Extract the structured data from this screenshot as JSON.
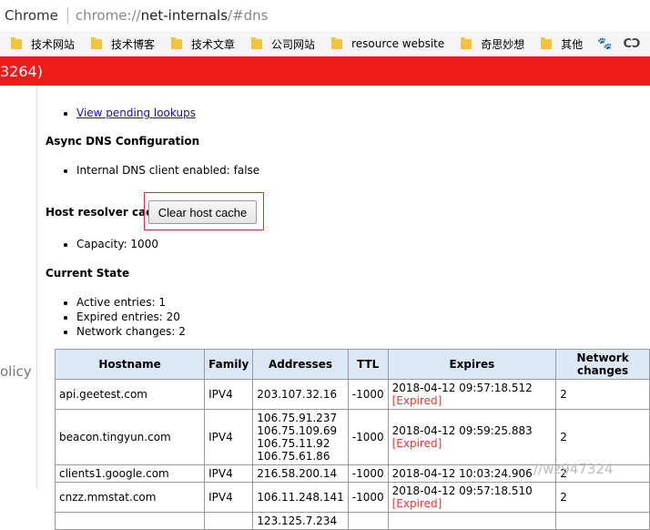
{
  "address_bar": {
    "app_name": "Chrome",
    "url_scheme": "chrome://",
    "url_host": "net-internals",
    "url_hash": "/#dns"
  },
  "bookmarks": [
    {
      "label": "技术网站",
      "icon": "folder-icon"
    },
    {
      "label": "技术博客",
      "icon": "folder-icon"
    },
    {
      "label": "技术文章",
      "icon": "folder-icon"
    },
    {
      "label": "公司网站",
      "icon": "folder-icon"
    },
    {
      "label": "resource website",
      "icon": "folder-icon"
    },
    {
      "label": "奇思妙想",
      "icon": "folder-icon"
    },
    {
      "label": "其他",
      "icon": "folder-icon"
    }
  ],
  "bookmark_extras": {
    "paw": "🐾",
    "cc": "CↃ",
    "jian": "简",
    "grid": "⊞"
  },
  "header": {
    "text": "3264)"
  },
  "sidebar": {
    "partial_label": "olicy"
  },
  "dns": {
    "pending_link": "View pending lookups",
    "async_title": "Async DNS Configuration",
    "async_items": [
      "Internal DNS client enabled: false"
    ],
    "host_cache_title": "Host resolver cache",
    "clear_button": "Clear host cache",
    "capacity": "Capacity: 1000",
    "current_state_title": "Current State",
    "state_items": [
      "Active entries: 1",
      "Expired entries: 20",
      "Network changes: 2"
    ]
  },
  "table": {
    "headers": [
      "Hostname",
      "Family",
      "Addresses",
      "TTL",
      "Expires",
      "Network changes"
    ],
    "rows": [
      {
        "hostname": "api.geetest.com",
        "family": "IPV4",
        "addresses": [
          "203.107.32.16"
        ],
        "ttl": "-1000",
        "expires": "2018-04-12 09:57:18.512",
        "expired": "[Expired]",
        "changes": "2"
      },
      {
        "hostname": "beacon.tingyun.com",
        "family": "IPV4",
        "addresses": [
          "106.75.91.237",
          "106.75.109.69",
          "106.75.11.92",
          "106.75.61.86"
        ],
        "ttl": "-1000",
        "expires": "2018-04-12 09:59:25.883",
        "expired": "[Expired]",
        "changes": "2"
      },
      {
        "hostname": "clients1.google.com",
        "family": "IPV4",
        "addresses": [
          "216.58.200.14"
        ],
        "ttl": "-1000",
        "expires": "2018-04-12 10:03:24.906",
        "expired": "",
        "changes": "2"
      },
      {
        "hostname": "cnzz.mmstat.com",
        "family": "IPV4",
        "addresses": [
          "106.11.248.141"
        ],
        "ttl": "-1000",
        "expires": "2018-04-12 09:57:18.510",
        "expired": "[Expired]",
        "changes": "2"
      },
      {
        "hostname": "",
        "family": "",
        "addresses": [
          "123.125.7.234"
        ],
        "ttl": "",
        "expires": "",
        "expired": "",
        "changes": ""
      }
    ]
  },
  "watermark": "//wz947324"
}
